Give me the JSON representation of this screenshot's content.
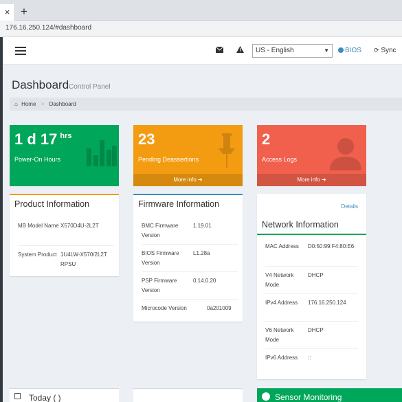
{
  "browser": {
    "tab_close": "×",
    "new_tab": "+",
    "url": "176.16.250.124/#dashboard"
  },
  "header": {
    "language": "US - English",
    "bios": "BIOS",
    "sync": "Sync",
    "icons": [
      "mail-icon",
      "warning-icon",
      "info-icon",
      "sync-icon"
    ]
  },
  "page": {
    "title": "Dashboard",
    "subtitle": "Control Panel"
  },
  "breadcrumb": {
    "home": "Home",
    "current": "Dashboard"
  },
  "boxes": {
    "power": {
      "value": "1 d 17",
      "unit": "hrs",
      "label": "Power-On Hours",
      "color": "#00a65a"
    },
    "pending": {
      "value": "23",
      "label": "Pending Deassertions",
      "more": "More info",
      "color": "#f39c12"
    },
    "access": {
      "value": "2",
      "label": "Access Logs",
      "more": "More info",
      "color": "#f0604d"
    }
  },
  "product": {
    "title": "Product Information",
    "rows": [
      {
        "key": "MB Model Name",
        "value": "X570D4U-2L2T"
      },
      {
        "key": "System Product",
        "value": "1U4LW-X570/2L2T RPSU"
      }
    ]
  },
  "firmware": {
    "title": "Firmware Information",
    "rows": [
      {
        "key": "BMC Firmware Version",
        "value": "1.19.01"
      },
      {
        "key": "BIOS Firmware Version",
        "value": "L1.28a"
      },
      {
        "key": "PSP Firmware Version",
        "value": "0.14.0.20"
      },
      {
        "key": "Microcode Version",
        "value": "0a201009"
      }
    ]
  },
  "network": {
    "details": "Details",
    "title": "Network Information",
    "rows": [
      {
        "key": "MAC Address",
        "value": "D0:50:99:F4:80:E6"
      },
      {
        "key": "V4 Network Mode",
        "value": "DHCP"
      },
      {
        "key": "IPv4 Address",
        "value": "176.16.250.124"
      },
      {
        "key": "V6 Network Mode",
        "value": "DHCP"
      },
      {
        "key": "IPv6 Address",
        "value": "::"
      }
    ]
  },
  "bottom": {
    "today": "Today ( )",
    "sensor": "Sensor Monitoring"
  }
}
